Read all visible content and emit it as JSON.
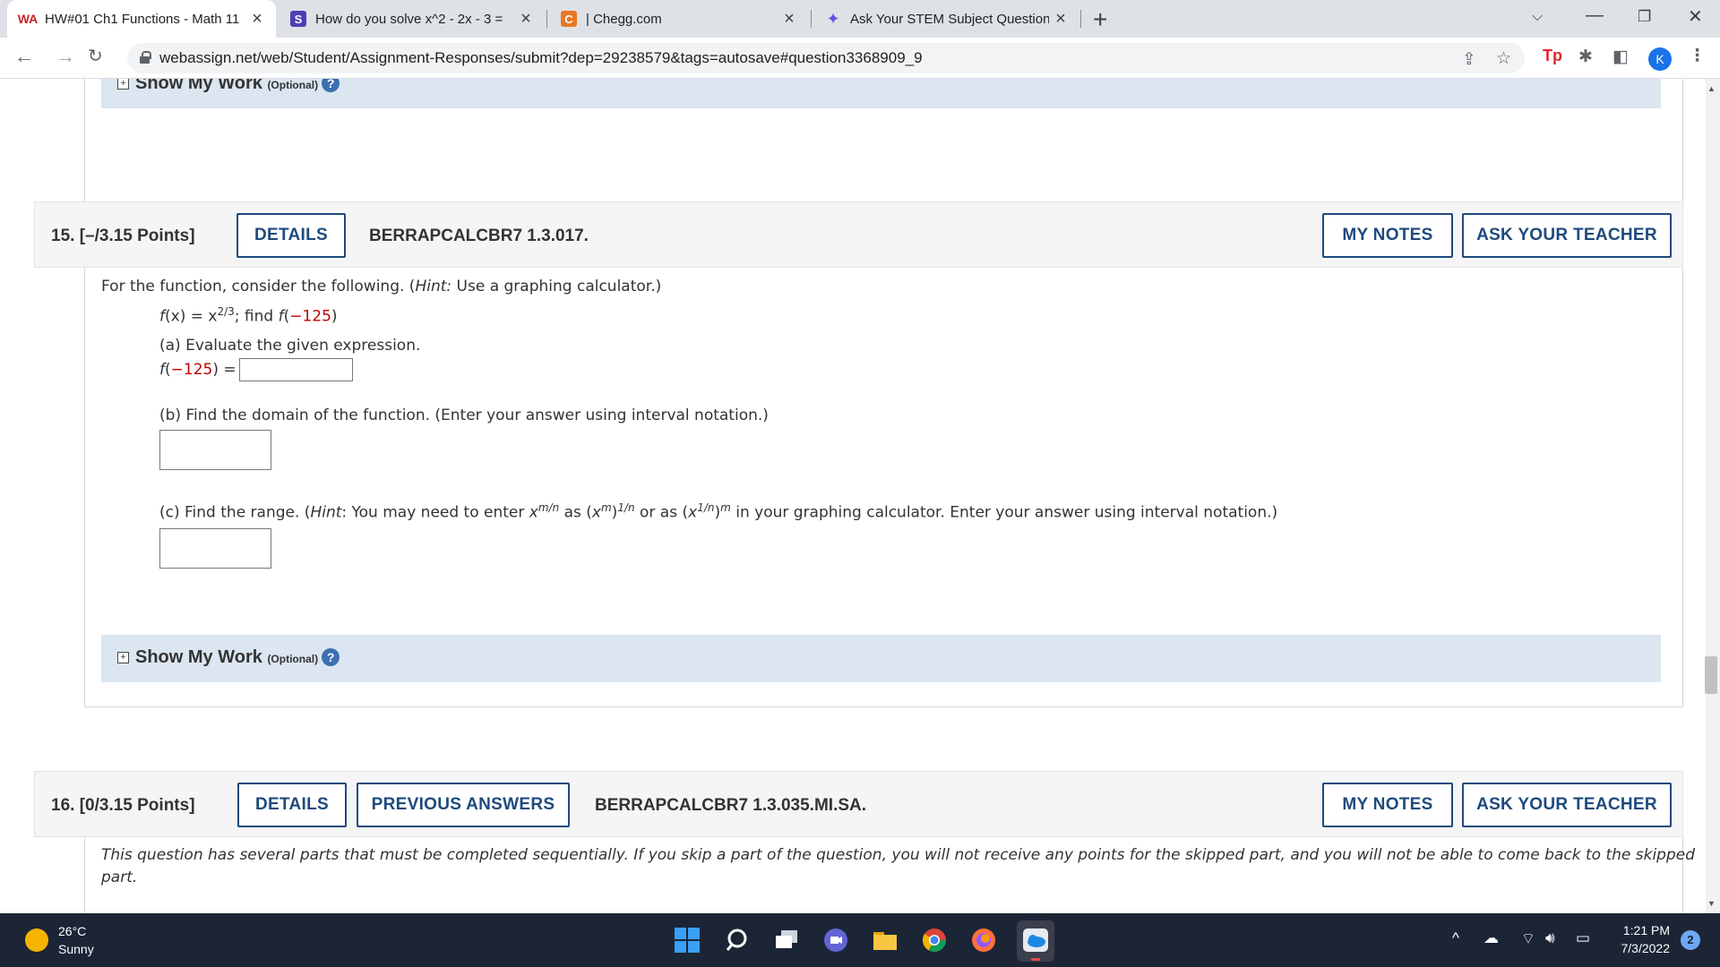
{
  "tabs": [
    {
      "title": "HW#01 Ch1 Functions - Math 11",
      "favicon": "WA",
      "active": true
    },
    {
      "title": "How do you solve x^2 - 2x - 3 =",
      "favicon": "S",
      "active": false
    },
    {
      "title": "| Chegg.com",
      "favicon": "C",
      "active": false
    },
    {
      "title": "Ask Your STEM Subject Question",
      "favicon": "✦",
      "active": false
    }
  ],
  "address": {
    "url": "webassign.net/web/Student/Assignment-Responses/submit?dep=29238579&tags=autosave#question3368909_9"
  },
  "profile": {
    "initial": "K"
  },
  "show_my_work": {
    "label": "Show My Work",
    "optional": "(Optional)",
    "help": "?"
  },
  "q15": {
    "number": "15.",
    "points": "[–/3.15 Points]",
    "details": "DETAILS",
    "code": "BERRAPCALCBR7 1.3.017.",
    "my_notes": "MY NOTES",
    "ask_teacher": "ASK YOUR TEACHER",
    "intro_pre": "For the function, consider the following. (",
    "hint_word": "Hint:",
    "intro_post": " Use a graphing calculator.)",
    "func_fx": "f",
    "func_x": "(x) = x",
    "func_exp": "2/3",
    "func_sep": ";  find ",
    "find_f": "f",
    "find_arg_open": "(",
    "find_arg": "−125",
    "find_arg_close": ")",
    "part_a": "(a) Evaluate the given expression.",
    "part_a_f": "f",
    "part_a_open": "(",
    "part_a_arg": "−125",
    "part_a_close": ") =",
    "part_b": "(b) Find the domain of the function. (Enter your answer using interval notation.)",
    "part_c_pre": "(c) Find the range. (",
    "part_c_hint": "Hint",
    "part_c_mid1": ": You may need to enter ",
    "c_x1": "x",
    "c_exp1": "m/n",
    "c_as": " as (",
    "c_x2": "x",
    "c_exp2": "m",
    "c_close2": ")",
    "c_exp3": "1/n",
    "c_or": " or as (",
    "c_x3": "x",
    "c_exp4": "1/n",
    "c_close3": ")",
    "c_exp5": "m",
    "c_post": " in your graphing calculator. Enter your answer using interval notation.)"
  },
  "q16": {
    "number": "16.",
    "points": "[0/3.15 Points]",
    "details": "DETAILS",
    "prev_answers": "PREVIOUS ANSWERS",
    "code": "BERRAPCALCBR7 1.3.035.MI.SA.",
    "my_notes": "MY NOTES",
    "ask_teacher": "ASK YOUR TEACHER",
    "notice_line1": "This question has several parts that must be completed sequentially. If you skip a part of the question, you will not receive any points for the skipped part, and you will not be able to come back to the skipped",
    "notice_line2": "part."
  },
  "taskbar": {
    "temp": "26°C",
    "condition": "Sunny",
    "time": "1:21 PM",
    "date": "7/3/2022",
    "notifications": "2"
  }
}
